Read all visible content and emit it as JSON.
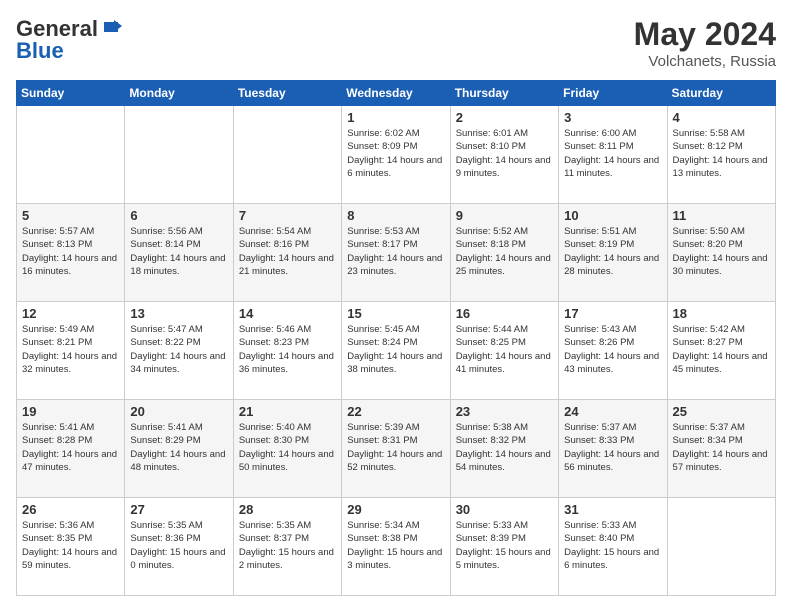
{
  "logo": {
    "general": "General",
    "blue": "Blue"
  },
  "header": {
    "month_year": "May 2024",
    "location": "Volchanets, Russia"
  },
  "weekdays": [
    "Sunday",
    "Monday",
    "Tuesday",
    "Wednesday",
    "Thursday",
    "Friday",
    "Saturday"
  ],
  "weeks": [
    [
      {
        "day": "",
        "sunrise": "",
        "sunset": "",
        "daylight": ""
      },
      {
        "day": "",
        "sunrise": "",
        "sunset": "",
        "daylight": ""
      },
      {
        "day": "",
        "sunrise": "",
        "sunset": "",
        "daylight": ""
      },
      {
        "day": "1",
        "sunrise": "Sunrise: 6:02 AM",
        "sunset": "Sunset: 8:09 PM",
        "daylight": "Daylight: 14 hours and 6 minutes."
      },
      {
        "day": "2",
        "sunrise": "Sunrise: 6:01 AM",
        "sunset": "Sunset: 8:10 PM",
        "daylight": "Daylight: 14 hours and 9 minutes."
      },
      {
        "day": "3",
        "sunrise": "Sunrise: 6:00 AM",
        "sunset": "Sunset: 8:11 PM",
        "daylight": "Daylight: 14 hours and 11 minutes."
      },
      {
        "day": "4",
        "sunrise": "Sunrise: 5:58 AM",
        "sunset": "Sunset: 8:12 PM",
        "daylight": "Daylight: 14 hours and 13 minutes."
      }
    ],
    [
      {
        "day": "5",
        "sunrise": "Sunrise: 5:57 AM",
        "sunset": "Sunset: 8:13 PM",
        "daylight": "Daylight: 14 hours and 16 minutes."
      },
      {
        "day": "6",
        "sunrise": "Sunrise: 5:56 AM",
        "sunset": "Sunset: 8:14 PM",
        "daylight": "Daylight: 14 hours and 18 minutes."
      },
      {
        "day": "7",
        "sunrise": "Sunrise: 5:54 AM",
        "sunset": "Sunset: 8:16 PM",
        "daylight": "Daylight: 14 hours and 21 minutes."
      },
      {
        "day": "8",
        "sunrise": "Sunrise: 5:53 AM",
        "sunset": "Sunset: 8:17 PM",
        "daylight": "Daylight: 14 hours and 23 minutes."
      },
      {
        "day": "9",
        "sunrise": "Sunrise: 5:52 AM",
        "sunset": "Sunset: 8:18 PM",
        "daylight": "Daylight: 14 hours and 25 minutes."
      },
      {
        "day": "10",
        "sunrise": "Sunrise: 5:51 AM",
        "sunset": "Sunset: 8:19 PM",
        "daylight": "Daylight: 14 hours and 28 minutes."
      },
      {
        "day": "11",
        "sunrise": "Sunrise: 5:50 AM",
        "sunset": "Sunset: 8:20 PM",
        "daylight": "Daylight: 14 hours and 30 minutes."
      }
    ],
    [
      {
        "day": "12",
        "sunrise": "Sunrise: 5:49 AM",
        "sunset": "Sunset: 8:21 PM",
        "daylight": "Daylight: 14 hours and 32 minutes."
      },
      {
        "day": "13",
        "sunrise": "Sunrise: 5:47 AM",
        "sunset": "Sunset: 8:22 PM",
        "daylight": "Daylight: 14 hours and 34 minutes."
      },
      {
        "day": "14",
        "sunrise": "Sunrise: 5:46 AM",
        "sunset": "Sunset: 8:23 PM",
        "daylight": "Daylight: 14 hours and 36 minutes."
      },
      {
        "day": "15",
        "sunrise": "Sunrise: 5:45 AM",
        "sunset": "Sunset: 8:24 PM",
        "daylight": "Daylight: 14 hours and 38 minutes."
      },
      {
        "day": "16",
        "sunrise": "Sunrise: 5:44 AM",
        "sunset": "Sunset: 8:25 PM",
        "daylight": "Daylight: 14 hours and 41 minutes."
      },
      {
        "day": "17",
        "sunrise": "Sunrise: 5:43 AM",
        "sunset": "Sunset: 8:26 PM",
        "daylight": "Daylight: 14 hours and 43 minutes."
      },
      {
        "day": "18",
        "sunrise": "Sunrise: 5:42 AM",
        "sunset": "Sunset: 8:27 PM",
        "daylight": "Daylight: 14 hours and 45 minutes."
      }
    ],
    [
      {
        "day": "19",
        "sunrise": "Sunrise: 5:41 AM",
        "sunset": "Sunset: 8:28 PM",
        "daylight": "Daylight: 14 hours and 47 minutes."
      },
      {
        "day": "20",
        "sunrise": "Sunrise: 5:41 AM",
        "sunset": "Sunset: 8:29 PM",
        "daylight": "Daylight: 14 hours and 48 minutes."
      },
      {
        "day": "21",
        "sunrise": "Sunrise: 5:40 AM",
        "sunset": "Sunset: 8:30 PM",
        "daylight": "Daylight: 14 hours and 50 minutes."
      },
      {
        "day": "22",
        "sunrise": "Sunrise: 5:39 AM",
        "sunset": "Sunset: 8:31 PM",
        "daylight": "Daylight: 14 hours and 52 minutes."
      },
      {
        "day": "23",
        "sunrise": "Sunrise: 5:38 AM",
        "sunset": "Sunset: 8:32 PM",
        "daylight": "Daylight: 14 hours and 54 minutes."
      },
      {
        "day": "24",
        "sunrise": "Sunrise: 5:37 AM",
        "sunset": "Sunset: 8:33 PM",
        "daylight": "Daylight: 14 hours and 56 minutes."
      },
      {
        "day": "25",
        "sunrise": "Sunrise: 5:37 AM",
        "sunset": "Sunset: 8:34 PM",
        "daylight": "Daylight: 14 hours and 57 minutes."
      }
    ],
    [
      {
        "day": "26",
        "sunrise": "Sunrise: 5:36 AM",
        "sunset": "Sunset: 8:35 PM",
        "daylight": "Daylight: 14 hours and 59 minutes."
      },
      {
        "day": "27",
        "sunrise": "Sunrise: 5:35 AM",
        "sunset": "Sunset: 8:36 PM",
        "daylight": "Daylight: 15 hours and 0 minutes."
      },
      {
        "day": "28",
        "sunrise": "Sunrise: 5:35 AM",
        "sunset": "Sunset: 8:37 PM",
        "daylight": "Daylight: 15 hours and 2 minutes."
      },
      {
        "day": "29",
        "sunrise": "Sunrise: 5:34 AM",
        "sunset": "Sunset: 8:38 PM",
        "daylight": "Daylight: 15 hours and 3 minutes."
      },
      {
        "day": "30",
        "sunrise": "Sunrise: 5:33 AM",
        "sunset": "Sunset: 8:39 PM",
        "daylight": "Daylight: 15 hours and 5 minutes."
      },
      {
        "day": "31",
        "sunrise": "Sunrise: 5:33 AM",
        "sunset": "Sunset: 8:40 PM",
        "daylight": "Daylight: 15 hours and 6 minutes."
      },
      {
        "day": "",
        "sunrise": "",
        "sunset": "",
        "daylight": ""
      }
    ]
  ]
}
